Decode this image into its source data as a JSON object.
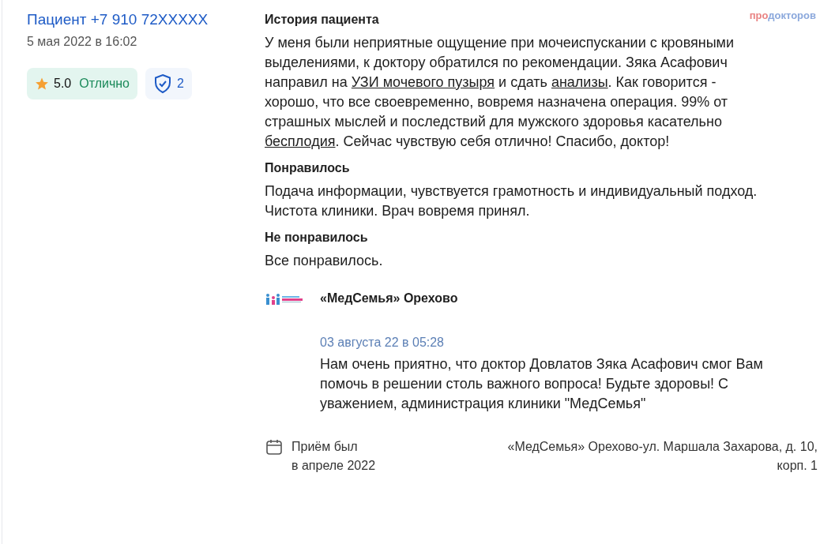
{
  "author": {
    "name": "Пациент +7 910 72XXXXX",
    "date": "5 мая 2022 в 16:02"
  },
  "rating": {
    "score": "5.0",
    "label": "Отлично"
  },
  "verified": {
    "count": "2"
  },
  "logo": {
    "parts": [
      "про",
      "докторов"
    ]
  },
  "sections": [
    {
      "title": "История пациента",
      "segments": [
        {
          "text": "У меня были неприятные ощущение при мочеиспускании с кровяными выделениями, к доктору обратился по рекомендации. Зяка Асафович направил на ",
          "link": false
        },
        {
          "text": "УЗИ мочевого пузыря",
          "link": true
        },
        {
          "text": " и сдать ",
          "link": false
        },
        {
          "text": "анализы",
          "link": true
        },
        {
          "text": ". Как говорится - хорошо, что все своевременно, вовремя назначена операция. 99% от страшных мыслей и последствий для мужского здоровья касательно ",
          "link": false
        },
        {
          "text": "бесплодия",
          "link": true
        },
        {
          "text": ". Сейчас чувствую себя отлично! Спасибо, доктор!",
          "link": false
        }
      ]
    },
    {
      "title": "Понравилось",
      "segments": [
        {
          "text": "Подача информации, чувствуется грамотность и индивидуальный подход. Чистота клиники. Врач вовремя принял.",
          "link": false
        }
      ]
    },
    {
      "title": "Не понравилось",
      "segments": [
        {
          "text": "Все понравилось.",
          "link": false
        }
      ]
    }
  ],
  "reply": {
    "clinic": "«МедСемья» Орехово",
    "date": "03 августа 22 в 05:28",
    "text": "Нам очень приятно, что доктор Довлатов Зяка Асафович смог Вам помочь в решении столь важного вопроса! Будьте здоровы! С уважением, администрация клиники \"МедСемья\""
  },
  "visit": {
    "lines": [
      "Приём был",
      "в апреле 2022"
    ],
    "address": "«МедСемья» Орехово-ул. Маршала Захарова, д. 10, корп. 1"
  }
}
